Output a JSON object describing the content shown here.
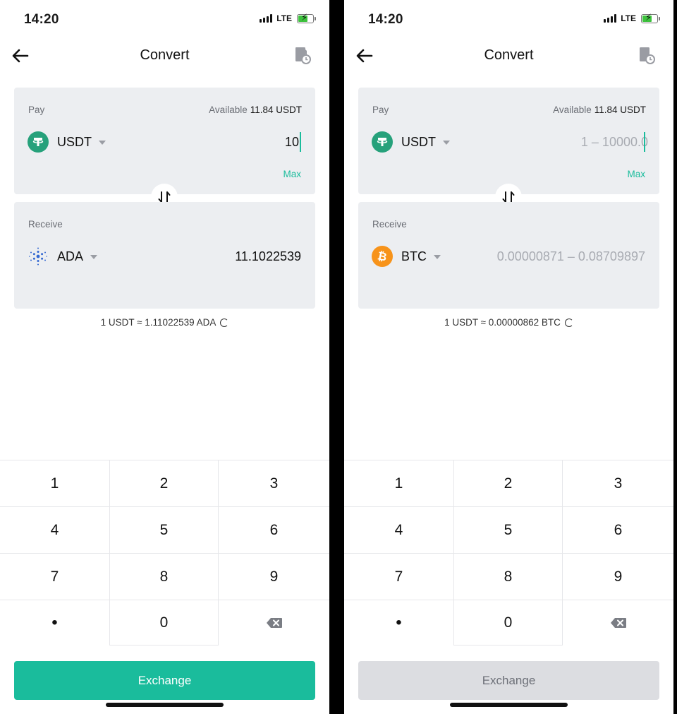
{
  "screens": {
    "left": {
      "status": {
        "time": "14:20",
        "network": "LTE"
      },
      "nav": {
        "title": "Convert"
      },
      "pay": {
        "label": "Pay",
        "available_label": "Available",
        "available_value": "11.84 USDT",
        "coin": "USDT",
        "amount": "10",
        "max_label": "Max"
      },
      "receive": {
        "label": "Receive",
        "coin": "ADA",
        "amount": "11.1022539"
      },
      "rate": "1 USDT ≈ 1.11022539 ADA",
      "keypad": [
        "1",
        "2",
        "3",
        "4",
        "5",
        "6",
        "7",
        "8",
        "9",
        "•",
        "0"
      ],
      "exchange_label": "Exchange",
      "exchange_enabled": true
    },
    "right": {
      "status": {
        "time": "14:20",
        "network": "LTE"
      },
      "nav": {
        "title": "Convert"
      },
      "pay": {
        "label": "Pay",
        "available_label": "Available",
        "available_value": "11.84 USDT",
        "coin": "USDT",
        "amount_placeholder": "1 – 10000.0",
        "max_label": "Max"
      },
      "receive": {
        "label": "Receive",
        "coin": "BTC",
        "amount_placeholder": "0.00000871 – 0.08709897"
      },
      "rate": "1 USDT ≈ 0.00000862 BTC",
      "keypad": [
        "1",
        "2",
        "3",
        "4",
        "5",
        "6",
        "7",
        "8",
        "9",
        "•",
        "0"
      ],
      "exchange_label": "Exchange",
      "exchange_enabled": false
    }
  },
  "colors": {
    "accent": "#1abc9c",
    "card_bg": "#eceef1",
    "usdt": "#26a17b",
    "btc": "#f7931a",
    "ada": "#3468d1"
  }
}
